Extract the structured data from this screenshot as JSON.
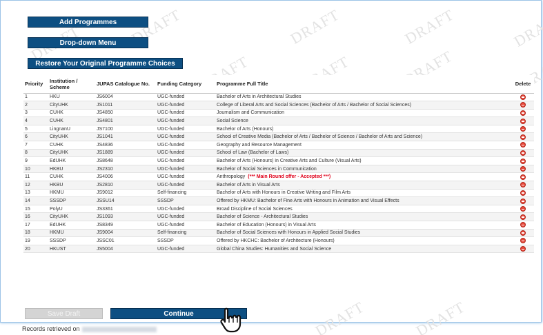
{
  "buttons": {
    "add_programmes": "Add Programmes",
    "dropdown_menu": "Drop-down Menu",
    "restore": "Restore Your Original Programme Choices",
    "save_draft": "Save Draft",
    "continue": "Continue"
  },
  "watermark": "DRAFT",
  "table": {
    "headers": {
      "priority": "Priority",
      "institution": "Institution / Scheme",
      "catalogue": "JUPAS Catalogue No.",
      "funding": "Funding Category",
      "title": "Programme Full Title",
      "delete": "Delete"
    },
    "rows": [
      {
        "priority": "1",
        "institution": "HKU",
        "catalogue": "JS6004",
        "funding": "UGC-funded",
        "title": "Bachelor of Arts in Architectural Studies",
        "remark": ""
      },
      {
        "priority": "2",
        "institution": "CityUHK",
        "catalogue": "JS1011",
        "funding": "UGC-funded",
        "title": "College of Liberal Arts and Social Sciences (Bachelor of Arts / Bachelor of Social Sciences)",
        "remark": ""
      },
      {
        "priority": "3",
        "institution": "CUHK",
        "catalogue": "JS4850",
        "funding": "UGC-funded",
        "title": "Journalism and Communication",
        "remark": ""
      },
      {
        "priority": "4",
        "institution": "CUHK",
        "catalogue": "JS4801",
        "funding": "UGC-funded",
        "title": "Social Science",
        "remark": ""
      },
      {
        "priority": "5",
        "institution": "LingnanU",
        "catalogue": "JS7100",
        "funding": "UGC-funded",
        "title": "Bachelor of Arts (Honours)",
        "remark": ""
      },
      {
        "priority": "6",
        "institution": "CityUHK",
        "catalogue": "JS1041",
        "funding": "UGC-funded",
        "title": "School of Creative Media (Bachelor of Arts / Bachelor of Science / Bachelor of Arts and Science)",
        "remark": ""
      },
      {
        "priority": "7",
        "institution": "CUHK",
        "catalogue": "JS4836",
        "funding": "UGC-funded",
        "title": "Geography and Resource Management",
        "remark": ""
      },
      {
        "priority": "8",
        "institution": "CityUHK",
        "catalogue": "JS1889",
        "funding": "UGC-funded",
        "title": "School of Law (Bachelor of Laws)",
        "remark": ""
      },
      {
        "priority": "9",
        "institution": "EdUHK",
        "catalogue": "JS8648",
        "funding": "UGC-funded",
        "title": "Bachelor of Arts (Honours) in Creative Arts and Culture (Visual Arts)",
        "remark": ""
      },
      {
        "priority": "10",
        "institution": "HKBU",
        "catalogue": "JS2310",
        "funding": "UGC-funded",
        "title": "Bachelor of Social Sciences in Communication",
        "remark": ""
      },
      {
        "priority": "11",
        "institution": "CUHK",
        "catalogue": "JS4006",
        "funding": "UGC-funded",
        "title": "Anthropology",
        "remark": "(*** Main Round offer - Accepted ***)"
      },
      {
        "priority": "12",
        "institution": "HKBU",
        "catalogue": "JS2810",
        "funding": "UGC-funded",
        "title": "Bachelor of Arts in Visual Arts",
        "remark": ""
      },
      {
        "priority": "13",
        "institution": "HKMU",
        "catalogue": "JS9012",
        "funding": "Self-financing",
        "title": "Bachelor of Arts with Honours in Creative Writing and Film Arts",
        "remark": ""
      },
      {
        "priority": "14",
        "institution": "SSSDP",
        "catalogue": "JSSU14",
        "funding": "SSSDP",
        "title": "Offered by HKMU: Bachelor of Fine Arts with Honours in Animation and Visual Effects",
        "remark": ""
      },
      {
        "priority": "15",
        "institution": "PolyU",
        "catalogue": "JS3361",
        "funding": "UGC-funded",
        "title": "Broad Discipline of Social Sciences",
        "remark": ""
      },
      {
        "priority": "16",
        "institution": "CityUHK",
        "catalogue": "JS1093",
        "funding": "UGC-funded",
        "title": "Bachelor of Science - Architectural Studies",
        "remark": ""
      },
      {
        "priority": "17",
        "institution": "EdUHK",
        "catalogue": "JS8349",
        "funding": "UGC-funded",
        "title": "Bachelor of Education (Honours) in Visual Arts",
        "remark": ""
      },
      {
        "priority": "18",
        "institution": "HKMU",
        "catalogue": "JS9004",
        "funding": "Self-financing",
        "title": "Bachelor of Social Sciences with Honours in Applied Social Studies",
        "remark": ""
      },
      {
        "priority": "19",
        "institution": "SSSDP",
        "catalogue": "JSSC01",
        "funding": "SSSDP",
        "title": "Offered by HKCHC: Bachelor of Architecture (Honours)",
        "remark": ""
      },
      {
        "priority": "20",
        "institution": "HKUST",
        "catalogue": "JS5004",
        "funding": "UGC-funded",
        "title": "Global China Studies: Humanities and Social Science",
        "remark": ""
      }
    ]
  },
  "footer": {
    "records_label": "Records retrieved on"
  },
  "icons": {
    "delete": "delete-minus-icon",
    "pointer": "hand-pointer-icon"
  },
  "colors": {
    "primary_button": "#0d4f82",
    "delete_icon": "#e84a3c",
    "remark_text": "#e0001a",
    "disabled_button": "#d4d4d4"
  }
}
